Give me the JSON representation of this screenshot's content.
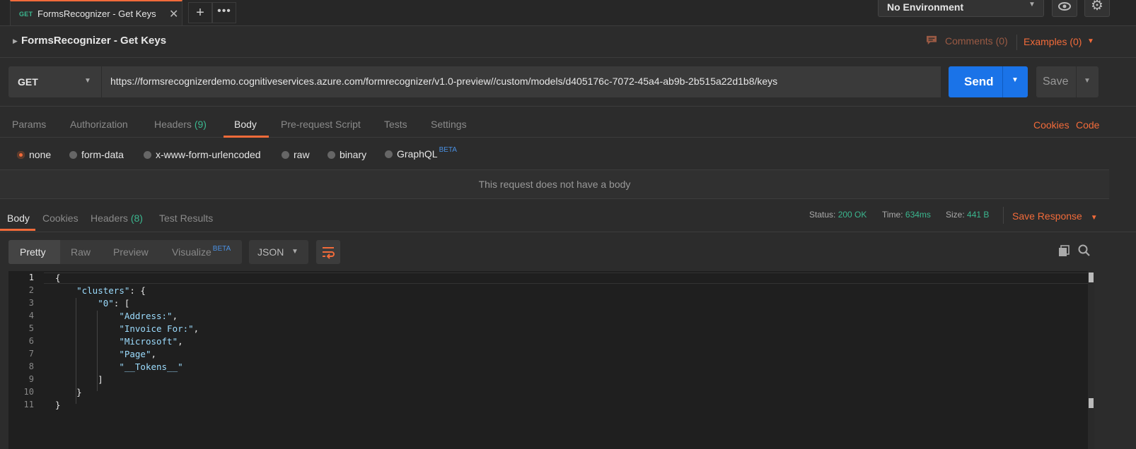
{
  "tabs": [
    {
      "method": "GET",
      "title": "FormsRecognizer - Get Keys",
      "close": "✕"
    }
  ],
  "tabbar": {
    "plus": "+",
    "more": "•••"
  },
  "environment": {
    "selected": "No Environment"
  },
  "request": {
    "name": "FormsRecognizer - Get Keys",
    "comments": "Comments (0)",
    "examples": "Examples (0)",
    "method": "GET",
    "url": "https://formsrecognizerdemo.cognitiveservices.azure.com/formrecognizer/v1.0-preview//custom/models/d405176c-7072-45a4-ab9b-2b515a22d1b8/keys",
    "send": "Send",
    "save": "Save"
  },
  "request_tabs": {
    "params": "Params",
    "authorization": "Authorization",
    "headers": "Headers",
    "headers_count": "(9)",
    "body": "Body",
    "prerequest": "Pre-request Script",
    "tests": "Tests",
    "settings": "Settings",
    "cookies": "Cookies",
    "code": "Code"
  },
  "body_types": {
    "none": "none",
    "form_data": "form-data",
    "urlencoded": "x-www-form-urlencoded",
    "raw": "raw",
    "binary": "binary",
    "graphql": "GraphQL",
    "beta": "BETA",
    "selected": "none"
  },
  "no_body_message": "This request does not have a body",
  "response": {
    "tabs": {
      "body": "Body",
      "cookies": "Cookies",
      "headers": "Headers",
      "headers_count": "(8)",
      "test_results": "Test Results"
    },
    "status_label": "Status:",
    "status_value": "200 OK",
    "time_label": "Time:",
    "time_value": "634ms",
    "size_label": "Size:",
    "size_value": "441 B",
    "save_response": "Save Response"
  },
  "viewer": {
    "pretty": "Pretty",
    "raw": "Raw",
    "preview": "Preview",
    "visualize": "Visualize",
    "beta": "BETA",
    "format": "JSON"
  },
  "code_lines": [
    "{",
    "    \"clusters\": {",
    "        \"0\": [",
    "            \"Address:\",",
    "            \"Invoice For:\",",
    "            \"Microsoft\",",
    "            \"Page\",",
    "            \"__Tokens__\"",
    "        ]",
    "    }",
    "}"
  ],
  "line_numbers": [
    "1",
    "2",
    "3",
    "4",
    "5",
    "6",
    "7",
    "8",
    "9",
    "10",
    "11"
  ],
  "colors": {
    "accent": "#f26b3a",
    "send": "#1a73e8",
    "success": "#3bb78f",
    "beta": "#4a90e2"
  },
  "icons": [
    "close-icon",
    "plus-icon",
    "more-icon",
    "eye-icon",
    "gear-icon",
    "caret-right-icon",
    "comment-icon",
    "chevron-down-icon",
    "wrap-icon",
    "copy-icon",
    "search-icon"
  ]
}
